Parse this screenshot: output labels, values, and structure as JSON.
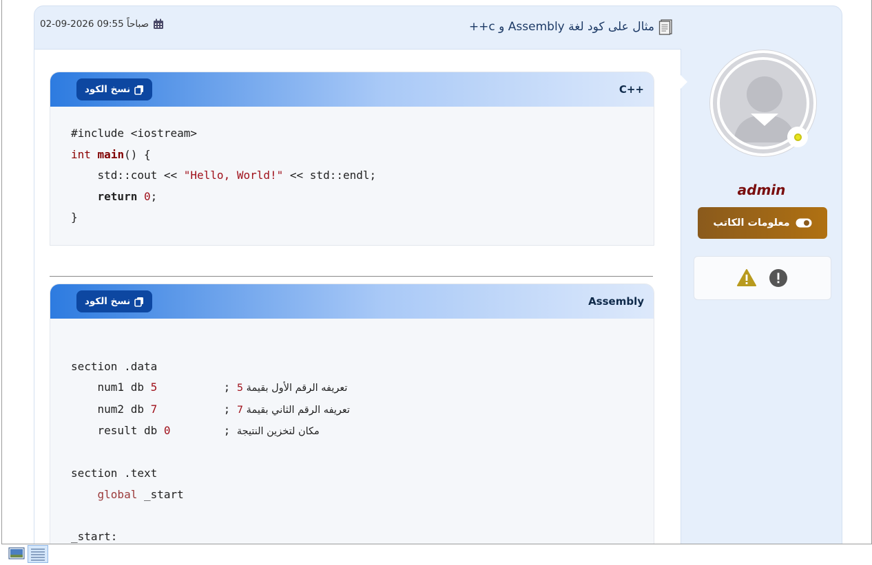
{
  "post": {
    "title": "مثال على كود لغة Assembly و c++",
    "datetime": "02-09-2026 09:55 صباحاً"
  },
  "blocks": [
    {
      "language": "C++",
      "copy_label": "نسخ الكود",
      "lines": [
        "#include <iostream>",
        "int main() {",
        "    std::cout << \"Hello, World!\" << std::endl;",
        "    return 0;",
        "}"
      ]
    },
    {
      "language": "Assembly",
      "copy_label": "نسخ الكود",
      "lines": [
        "",
        "section .data",
        "    num1 db 5         ; تعريفه الرقم الأول بقيمة 5",
        "    num2 db 7         ; تعريفه الرقم الثاني بقيمة 7",
        "    result db 0       ; مكان لتخزين النتيجة",
        "",
        "section .text",
        "    global _start",
        "",
        "_start:"
      ]
    }
  ],
  "author": {
    "username": "admin",
    "info_button": "معلومات الكاتب",
    "status_color": "#e8e420"
  },
  "actions": {
    "icons": [
      "info-circle-icon",
      "warning-triangle-icon"
    ]
  },
  "colors": {
    "accent": "#0d47a1",
    "username": "#7a0e0e",
    "author_button": "#9a6417"
  }
}
